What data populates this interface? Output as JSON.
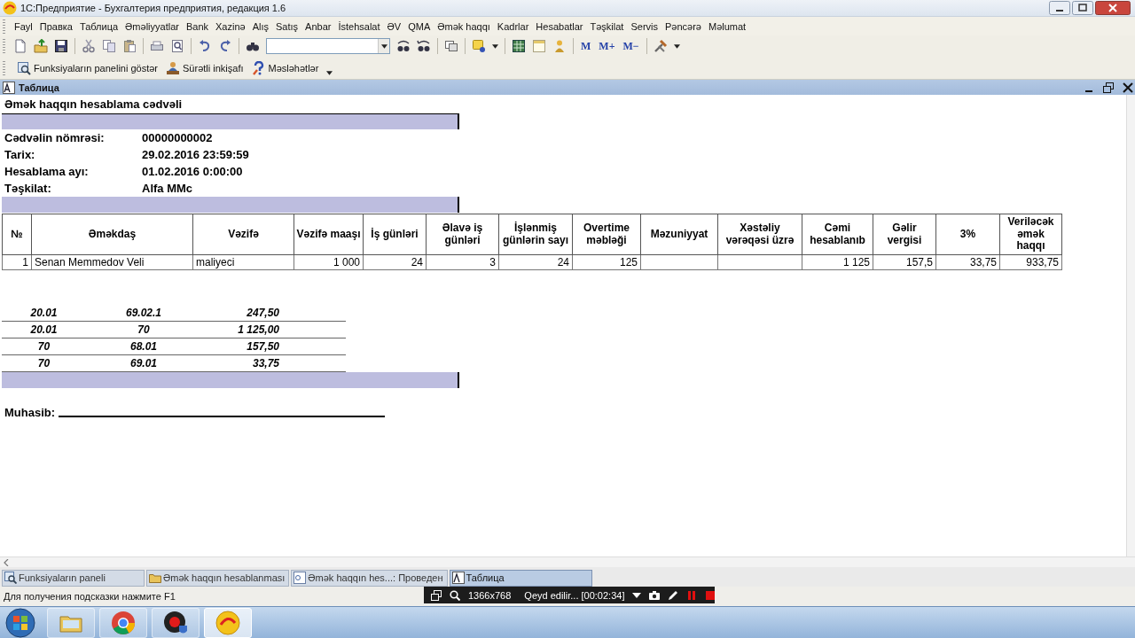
{
  "window": {
    "title": "1C:Предприятие - Бухгалтерия предприятия, редакция 1.6"
  },
  "menu": [
    "Fayl",
    "Правка",
    "Таблица",
    "Əməliyyatlar",
    "Bank",
    "Xazinə",
    "Alış",
    "Satış",
    "Anbar",
    "İstehsalat",
    "ƏV",
    "QMA",
    "Əmək haqqı",
    "Kadrlar",
    "Hesabatlar",
    "Təşkilat",
    "Servis",
    "Pəncərə",
    "Məlumat"
  ],
  "toolbar": {
    "memory_buttons": [
      "M",
      "M+",
      "M−"
    ]
  },
  "panel_toolbar": [
    "Funksiyaların panelini göstər",
    "Sürətli inkişafı",
    "Məsləhətlər"
  ],
  "document_window": {
    "title": "Таблица"
  },
  "report": {
    "title": "Əmək haqqın hesablama cədvəli",
    "fields": [
      {
        "label": "Cədvəlin nömrəsi:",
        "value": "00000000002"
      },
      {
        "label": "Tarix:",
        "value": "29.02.2016 23:59:59"
      },
      {
        "label": "Hesablama ayı:",
        "value": "01.02.2016 0:00:00"
      },
      {
        "label": "Təşkilat:",
        "value": "Alfa MMc"
      }
    ],
    "table": {
      "columns": [
        "№",
        "Əməkdaş",
        "Vəzifə",
        "Vəzifə maaşı",
        "İş günləri",
        "Əlavə iş günləri",
        "İşlənmiş günlərin sayı",
        "Overtime məbləği",
        "Məzuniyyat",
        "Xəstəliy vərəqəsi üzrə",
        "Cəmi hesablanıb",
        "Gəlir vergisi",
        "3%",
        "Veriləcək əmək haqqı"
      ],
      "rows": [
        [
          "1",
          "Senan Memmedov Veli",
          "maliyeci",
          "1 000",
          "24",
          "3",
          "24",
          "125",
          null,
          null,
          "1 125",
          "157,5",
          "33,75",
          "933,75"
        ]
      ]
    },
    "entries": [
      [
        "20.01",
        "69.02.1",
        "247,50"
      ],
      [
        "20.01",
        "70",
        "1 125,00"
      ],
      [
        "70",
        "68.01",
        "157,50"
      ],
      [
        "70",
        "69.01",
        "33,75"
      ]
    ],
    "signature": {
      "label": "Muhasib:"
    }
  },
  "window_tabs": [
    {
      "label": "Funksiyaların paneli",
      "selected": false
    },
    {
      "label": "Əmək haqqın hesablanması",
      "selected": false
    },
    {
      "label": "Əmək haqqın hes...: Проведен",
      "selected": false
    },
    {
      "label": "Таблица",
      "selected": true
    }
  ],
  "status_bar": {
    "text": "Для получения подсказки нажмите F1"
  },
  "taskbar": {
    "apps": [
      {
        "selected": false
      },
      {
        "selected": false
      },
      {
        "selected": false
      },
      {
        "selected": true
      }
    ]
  },
  "recorder": {
    "resolution": "1366x768",
    "status": "Qeyd edilir... [00:02:34]"
  }
}
